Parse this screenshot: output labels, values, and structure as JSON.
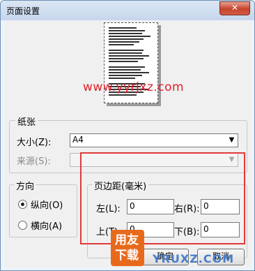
{
  "window": {
    "title": "页面设置",
    "close_label": "✕"
  },
  "preview": {
    "watermark": "www.yyrjxz.com"
  },
  "paper": {
    "legend": "纸张",
    "size_label": "大小(Z):",
    "size_value": "A4",
    "source_label": "来源(S):",
    "source_value": ""
  },
  "orientation": {
    "legend": "方向",
    "portrait_label": "纵向(O)",
    "landscape_label": "横向(A)",
    "selected": "portrait"
  },
  "margins": {
    "legend": "页边距(毫米)",
    "left_label": "左(L):",
    "left_value": "0",
    "right_label": "右(R):",
    "right_value": "0",
    "top_label": "上(T):",
    "top_value": "0",
    "bottom_label": "下(B):",
    "bottom_value": "0"
  },
  "buttons": {
    "ok": "确定",
    "cancel": "取消"
  },
  "overlay_logo": {
    "text": "用友下载",
    "site": "YRUXZ.COM"
  }
}
